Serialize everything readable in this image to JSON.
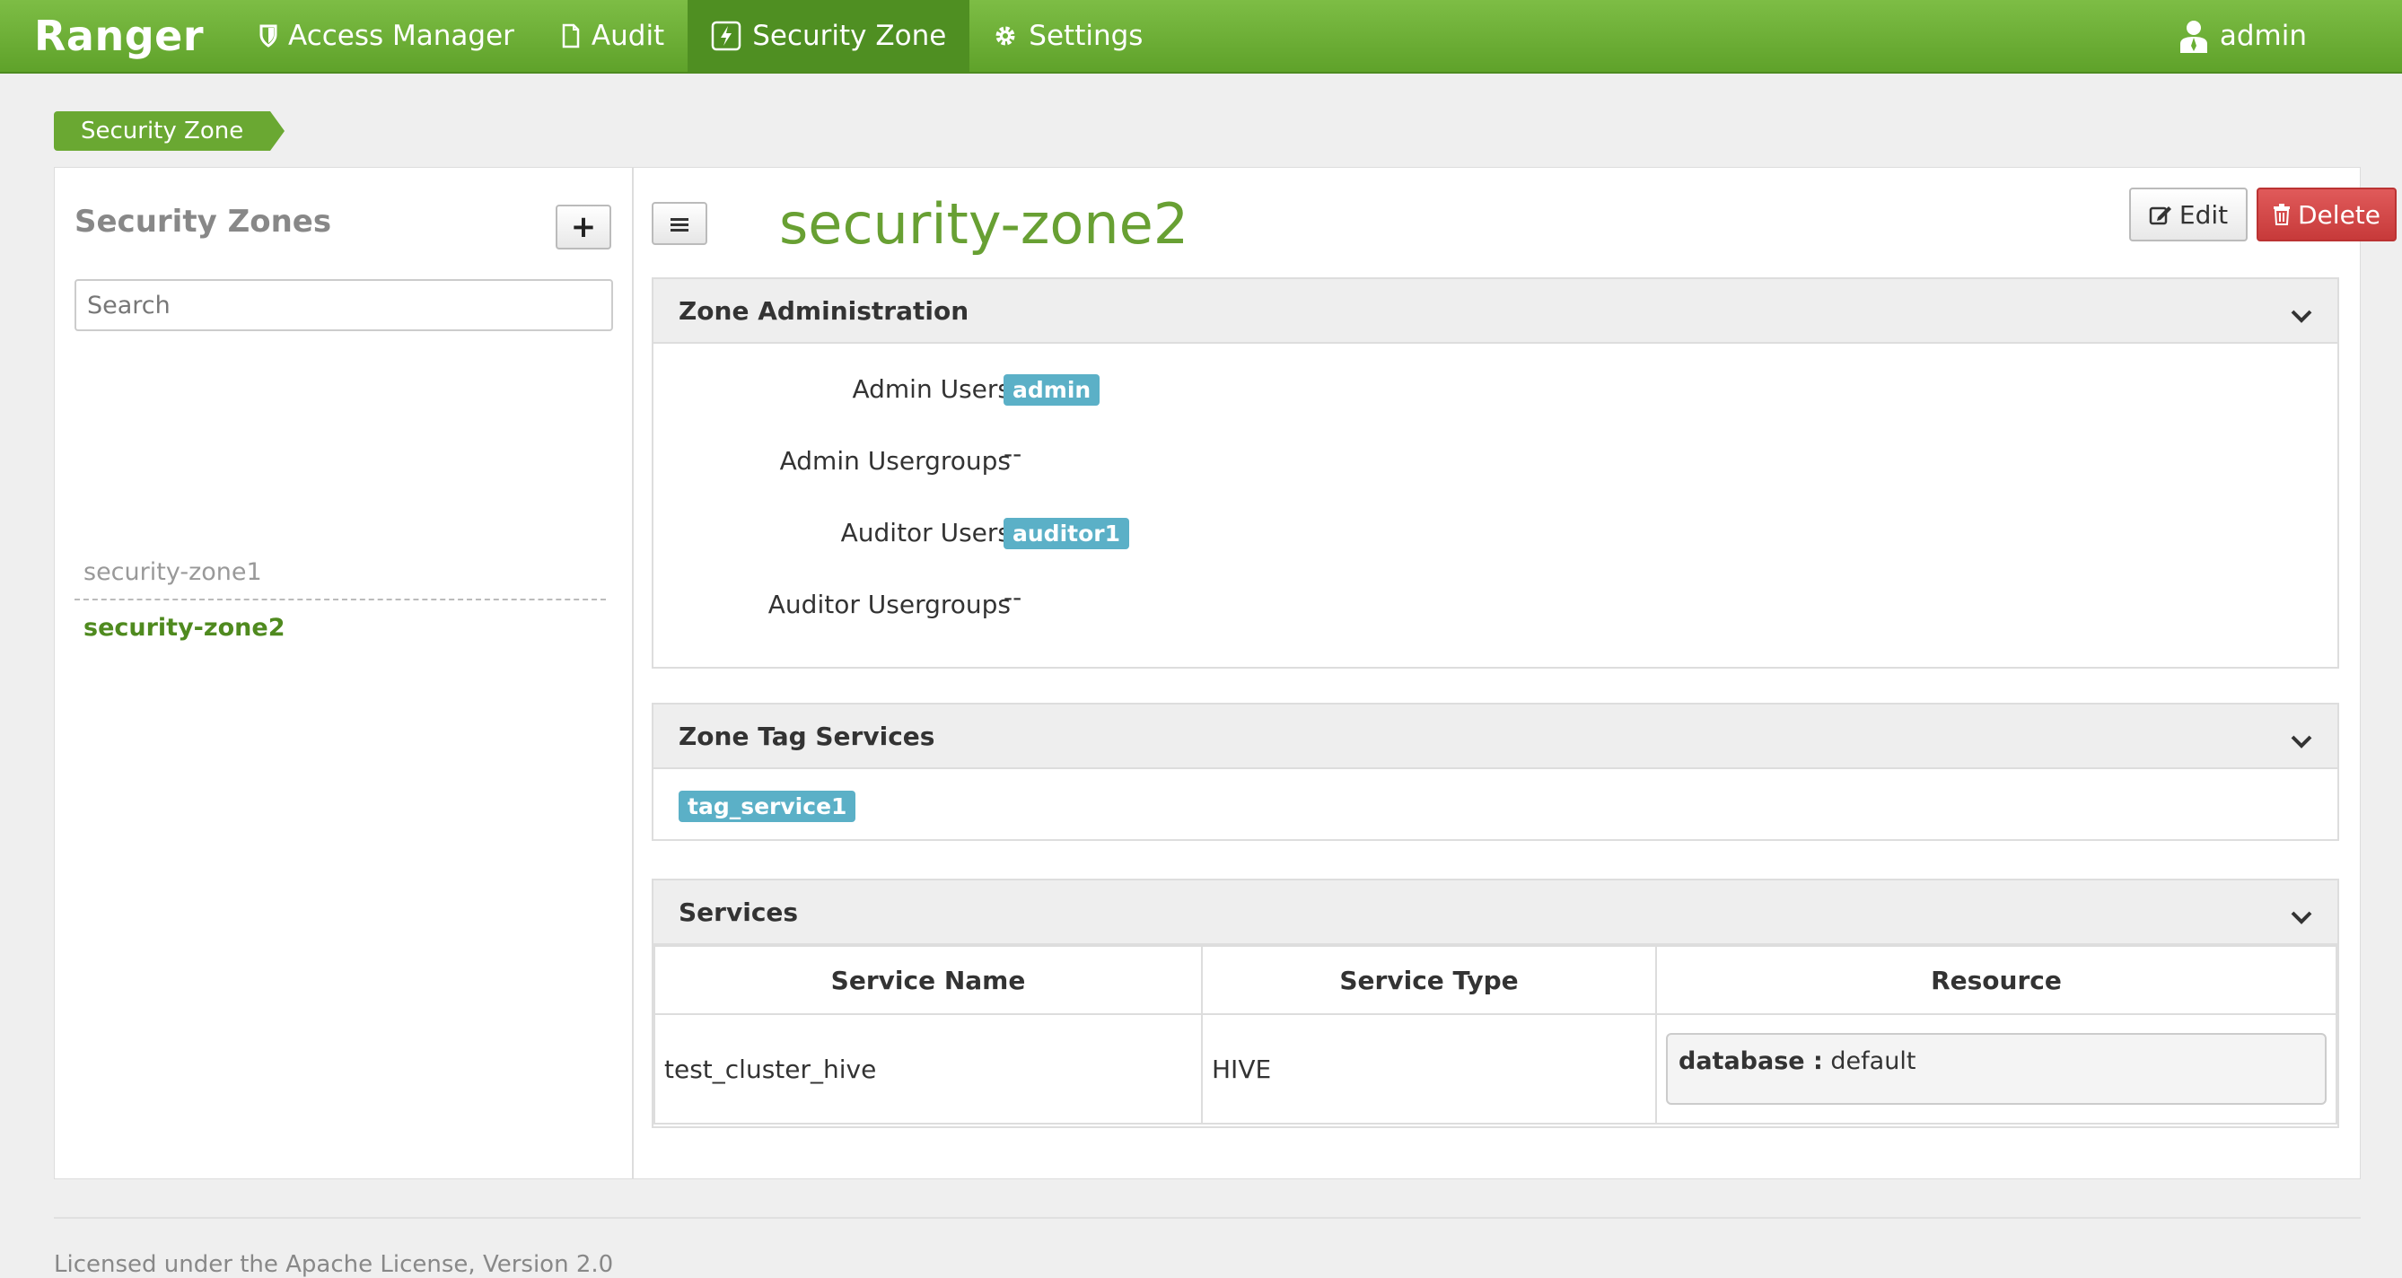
{
  "navbar": {
    "brand": "Ranger",
    "items": [
      {
        "label": "Access Manager",
        "icon": "shield-icon"
      },
      {
        "label": "Audit",
        "icon": "file-icon"
      },
      {
        "label": "Security Zone",
        "icon": "lightning-icon",
        "active": true
      },
      {
        "label": "Settings",
        "icon": "gear-icon"
      }
    ],
    "user": "admin"
  },
  "breadcrumb": "Security Zone",
  "sidebar": {
    "title": "Security Zones",
    "add_label": "+",
    "search_placeholder": "Search",
    "zones": [
      "security-zone1",
      "security-zone2"
    ]
  },
  "zone": {
    "name": "security-zone2",
    "edit_label": "Edit",
    "delete_label": "Delete"
  },
  "admin_panel": {
    "title": "Zone Administration",
    "rows": [
      {
        "label": "Admin Users",
        "value": "admin",
        "badge": true
      },
      {
        "label": "Admin Usergroups",
        "value": "--",
        "badge": false
      },
      {
        "label": "Auditor Users",
        "value": "auditor1",
        "badge": true
      },
      {
        "label": "Auditor Usergroups",
        "value": "--",
        "badge": false
      }
    ]
  },
  "tag_panel": {
    "title": "Zone Tag Services",
    "service": "tag_service1"
  },
  "services_panel": {
    "title": "Services",
    "headers": [
      "Service Name",
      "Service Type",
      "Resource"
    ],
    "rows": [
      {
        "name": "test_cluster_hive",
        "type": "HIVE",
        "resource_key": "database :",
        "resource_value": "default"
      }
    ]
  },
  "footer": "Licensed under the Apache License, Version 2.0",
  "colors": {
    "navbar": "#6aaf34",
    "accent": "#68a033",
    "badge": "#5bb0c7",
    "danger": "#c73a3a"
  }
}
